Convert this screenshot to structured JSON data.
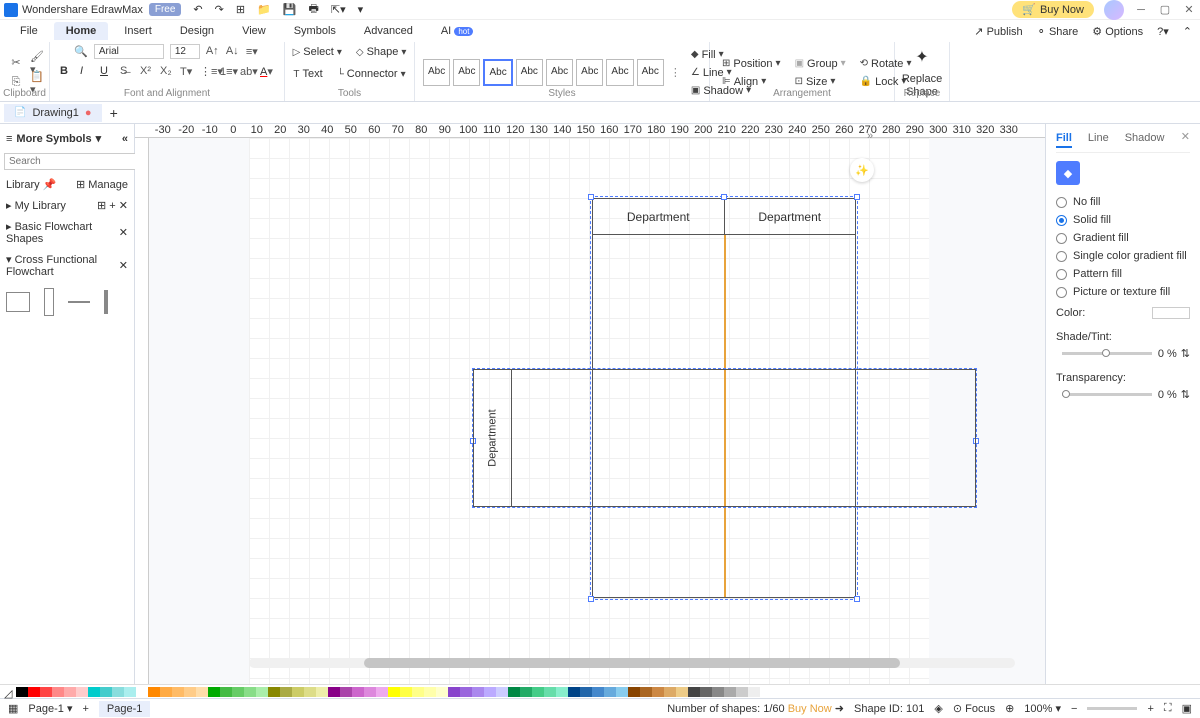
{
  "app": {
    "title": "Wondershare EdrawMax",
    "tag": "Free",
    "buy": "Buy Now"
  },
  "menu": {
    "items": [
      "File",
      "Home",
      "Insert",
      "Design",
      "View",
      "Symbols",
      "Advanced",
      "AI"
    ],
    "active": 1,
    "hot": "hot",
    "right": [
      "Publish",
      "Share",
      "Options"
    ]
  },
  "ribbon": {
    "clipboard": "Clipboard",
    "font": {
      "name": "Arial",
      "size": "12",
      "label": "Font and Alignment"
    },
    "tools": {
      "select": "Select",
      "shape": "Shape",
      "text": "Text",
      "connector": "Connector",
      "label": "Tools"
    },
    "styles": {
      "abc": "Abc",
      "label": "Styles",
      "fill": "Fill",
      "line": "Line",
      "shadow": "Shadow"
    },
    "arrange": {
      "position": "Position",
      "group": "Group",
      "rotate": "Rotate",
      "align": "Align",
      "size": "Size",
      "lock": "Lock",
      "label": "Arrangement"
    },
    "replace": {
      "btn": "Replace\nShape",
      "label": "Replace"
    }
  },
  "doc": {
    "name": "Drawing1"
  },
  "ruler": [
    "-30",
    "-20",
    "-10",
    "0",
    "10",
    "20",
    "30",
    "40",
    "50",
    "60",
    "70",
    "80",
    "90",
    "100",
    "110",
    "120",
    "130",
    "140",
    "150",
    "160",
    "170",
    "180",
    "190",
    "200",
    "210",
    "220",
    "230",
    "240",
    "250",
    "260",
    "270",
    "280",
    "290",
    "300",
    "310",
    "320",
    "330"
  ],
  "left": {
    "header": "More Symbols",
    "search": {
      "placeholder": "Search",
      "btn": "Search"
    },
    "library": "Library",
    "manage": "Manage",
    "items": [
      "My Library",
      "Basic Flowchart Shapes",
      "Cross Functional Flowchart"
    ]
  },
  "canvas": {
    "dept": "Department"
  },
  "right": {
    "tabs": [
      "Fill",
      "Line",
      "Shadow"
    ],
    "active": 0,
    "fills": [
      "No fill",
      "Solid fill",
      "Gradient fill",
      "Single color gradient fill",
      "Pattern fill",
      "Picture or texture fill"
    ],
    "selected": 1,
    "color": "Color:",
    "shade": "Shade/Tint:",
    "trans": "Transparency:",
    "shadeVal": "0 %",
    "transVal": "0 %"
  },
  "status": {
    "page": "Page-1",
    "pageTab": "Page-1",
    "shapes": "Number of shapes: 1/60",
    "buy": "Buy Now",
    "shapeId": "Shape ID: 101",
    "focus": "Focus",
    "zoom": "100%"
  },
  "palette": [
    "#000",
    "#f00",
    "#f44",
    "#f88",
    "#faa",
    "#fcc",
    "#0cc",
    "#4cc",
    "#8dd",
    "#aee",
    "#fff",
    "#f80",
    "#fa4",
    "#fb6",
    "#fc8",
    "#fda",
    "#0a0",
    "#4b4",
    "#6c6",
    "#8d8",
    "#aea",
    "#880",
    "#aa4",
    "#cc6",
    "#dd8",
    "#eea",
    "#808",
    "#a4a",
    "#c6c",
    "#d8d",
    "#eae",
    "#ff0",
    "#ff4",
    "#ff8",
    "#ffa",
    "#ffc",
    "#84c",
    "#96d",
    "#a8e",
    "#baf",
    "#ccf",
    "#084",
    "#2a6",
    "#4c8",
    "#6da",
    "#8ec",
    "#048",
    "#26a",
    "#48c",
    "#6ad",
    "#8ce",
    "#840",
    "#a62",
    "#c84",
    "#da6",
    "#ec8",
    "#444",
    "#666",
    "#888",
    "#aaa",
    "#ccc",
    "#eee"
  ]
}
